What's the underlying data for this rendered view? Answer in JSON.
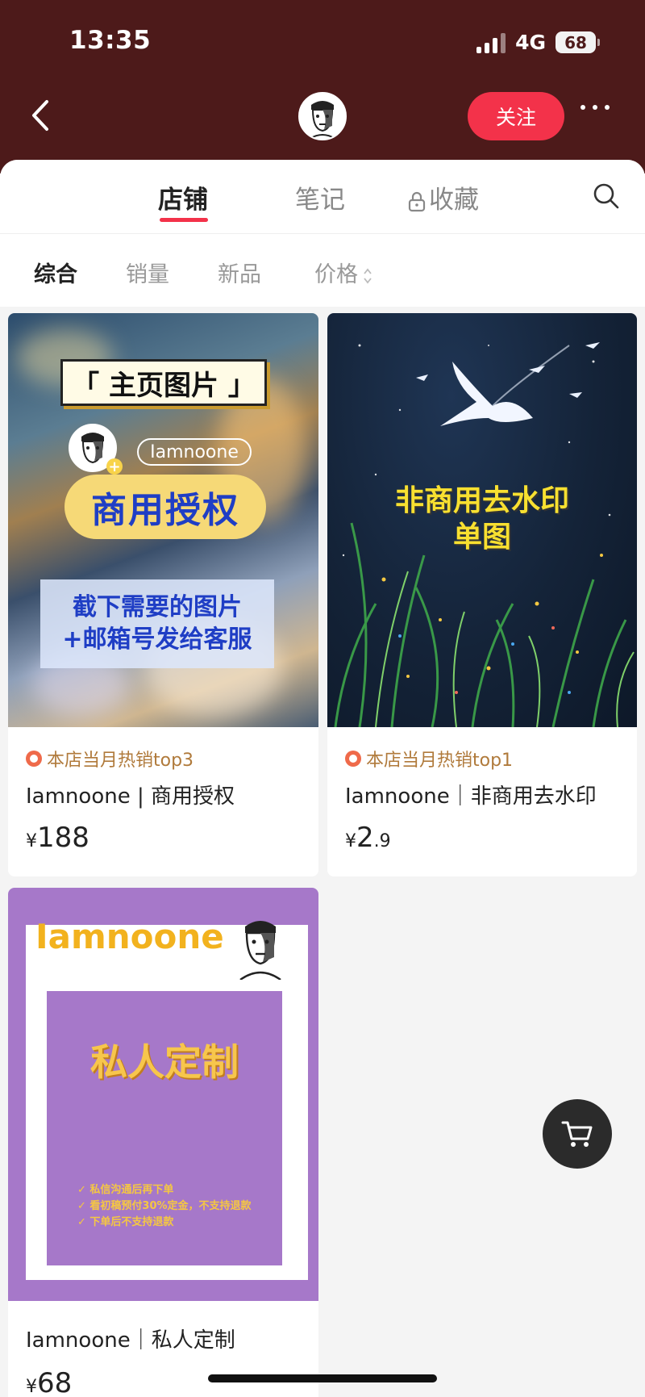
{
  "status": {
    "time": "13:35",
    "network": "4G",
    "battery": "68"
  },
  "header": {
    "follow_label": "关注"
  },
  "tabs": [
    {
      "label": "店铺"
    },
    {
      "label": "笔记"
    },
    {
      "label": "收藏"
    }
  ],
  "filters": [
    {
      "label": "综合"
    },
    {
      "label": "销量"
    },
    {
      "label": "新品"
    },
    {
      "label": "价格"
    }
  ],
  "products": [
    {
      "tag": "本店当月热销top3",
      "title": "Iamnoone | 商用授权",
      "price_symbol": "¥",
      "price": "188",
      "image": {
        "badge": "「 主页图片 」",
        "handle": "Iamnoone",
        "headline": "商用授权",
        "line1": "截下需要的图片",
        "line2": "+邮箱号发给客服"
      }
    },
    {
      "tag": "本店当月热销top1",
      "title": "Iamnoone｜非商用去水印",
      "price_symbol": "¥",
      "price_int": "2",
      "price_dec": ".9",
      "image": {
        "line1": "非商用去水印",
        "line2": "单图"
      }
    },
    {
      "title": "Iamnoone｜私人定制",
      "price_symbol": "¥",
      "price": "68",
      "image": {
        "brand": "Iamnoone",
        "headline": "私人定制",
        "notes": [
          "✓ 私信沟通后再下单",
          "✓ 看初稿预付30%定金，不支持退款",
          "✓ 下单后不支持退款"
        ]
      }
    }
  ],
  "colors": {
    "header_bg": "#4d1a1a",
    "accent": "#f3324a",
    "tag": "#b07a3b"
  }
}
